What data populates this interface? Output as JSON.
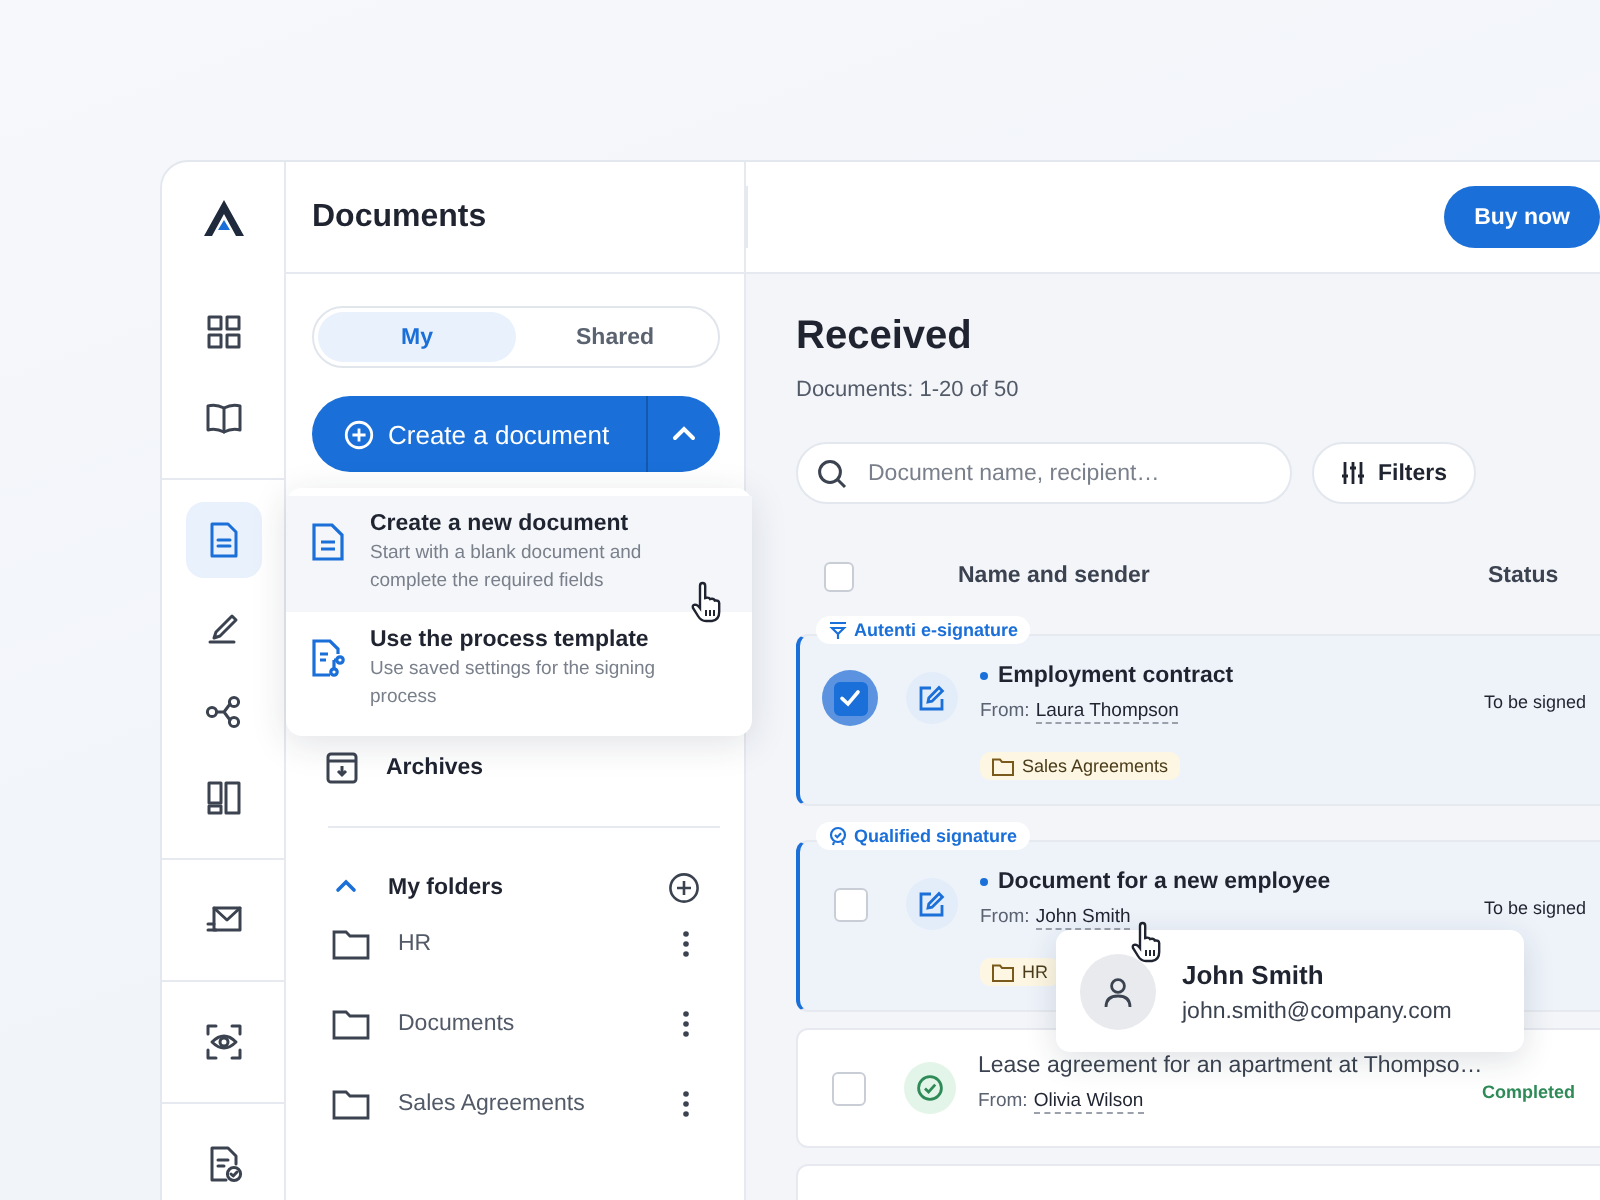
{
  "app": {
    "title": "Documents",
    "buy_button": "Buy now"
  },
  "nav_groups": [
    {
      "items": [
        {
          "kind": "grid",
          "selected": false
        },
        {
          "kind": "book",
          "selected": false
        }
      ]
    },
    {
      "items": [
        {
          "kind": "document",
          "selected": true
        },
        {
          "kind": "pen",
          "selected": false
        },
        {
          "kind": "share",
          "selected": false
        },
        {
          "kind": "layout",
          "selected": false
        }
      ]
    },
    {
      "items": [
        {
          "kind": "mail",
          "selected": false
        }
      ]
    },
    {
      "items": [
        {
          "kind": "scan",
          "selected": false
        }
      ]
    },
    {
      "items": [
        {
          "kind": "doc-check",
          "selected": false
        }
      ]
    }
  ],
  "sidebar": {
    "tabs": [
      {
        "label": "My",
        "selected": true
      },
      {
        "label": "Shared",
        "selected": false
      }
    ],
    "create_button": {
      "label": "Create a document",
      "expanded": true
    },
    "create_menu": [
      {
        "kind": "document",
        "title": "Create a new document",
        "description": "Start with a blank document and complete the required fields",
        "hovered": true
      },
      {
        "kind": "template",
        "title": "Use the process template",
        "description": "Use saved settings for the signing process",
        "hovered": false
      }
    ],
    "archives": "Archives",
    "folders_section": {
      "title": "My folders",
      "expanded": true,
      "folders": [
        "HR",
        "Documents",
        "Sales Agreements"
      ]
    }
  },
  "main": {
    "title": "Received",
    "count": "Documents: 1-20 of 50",
    "search": {
      "placeholder": "Document name, recipient…"
    },
    "filters_button": "Filters",
    "select_all": false,
    "columns": [
      "Name and sender",
      "Status"
    ],
    "rows": [
      {
        "signature": {
          "kind": "e-signature",
          "label": "Autenti e-signature"
        },
        "checked": true,
        "unread": true,
        "kind": "pending",
        "title": "Employment contract",
        "from_label": "From:",
        "sender": "Laura Thompson",
        "folder": "Sales Agreements",
        "status": "To be signed"
      },
      {
        "signature": {
          "kind": "qualified",
          "label": "Qualified signature"
        },
        "checked": false,
        "unread": true,
        "kind": "pending",
        "title": "Document for a new employee",
        "from_label": "From:",
        "sender": "John Smith",
        "folder": "HR",
        "status": "To be signed",
        "sender_card": {
          "name": "John Smith",
          "email": "john.smith@company.com"
        }
      },
      {
        "checked": false,
        "unread": false,
        "kind": "completed",
        "title": "Lease agreement for an apartment at Thompso…",
        "from_label": "From:",
        "sender": "Olivia Wilson",
        "status": "Completed"
      }
    ]
  }
}
